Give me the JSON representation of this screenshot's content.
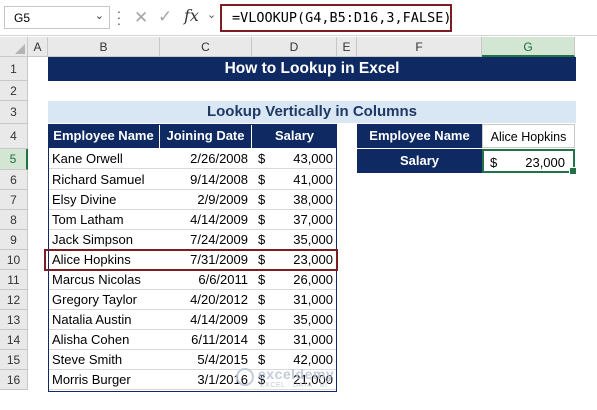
{
  "formula_bar": {
    "name_box": "G5",
    "formula": "=VLOOKUP(G4,B5:D16,3,FALSE)",
    "fx_label": "fx"
  },
  "columns": [
    "A",
    "B",
    "C",
    "D",
    "E",
    "F",
    "G"
  ],
  "rows": [
    "1",
    "2",
    "3",
    "4",
    "5",
    "6",
    "7",
    "8",
    "9",
    "10",
    "11",
    "12",
    "13",
    "14",
    "15",
    "16"
  ],
  "selected_cell": {
    "column": "G",
    "row": "5"
  },
  "sheet": {
    "title": "How to Lookup in Excel",
    "subtitle": "Lookup Vertically in Columns"
  },
  "table": {
    "headers": [
      "Employee Name",
      "Joining Date",
      "Salary"
    ],
    "currency_symbol": "$",
    "rows": [
      {
        "name": "Kane Orwell",
        "date": "2/26/2008",
        "salary": "43,000"
      },
      {
        "name": "Richard Samuel",
        "date": "9/14/2008",
        "salary": "41,000"
      },
      {
        "name": "Elsy Divine",
        "date": "2/9/2009",
        "salary": "38,000"
      },
      {
        "name": "Tom Latham",
        "date": "4/14/2009",
        "salary": "37,000"
      },
      {
        "name": "Jack Simpson",
        "date": "7/24/2009",
        "salary": "35,000"
      },
      {
        "name": "Alice Hopkins",
        "date": "7/31/2009",
        "salary": "23,000"
      },
      {
        "name": "Marcus Nicolas",
        "date": "6/6/2011",
        "salary": "26,000"
      },
      {
        "name": "Gregory Taylor",
        "date": "4/20/2012",
        "salary": "31,000"
      },
      {
        "name": "Natalia Austin",
        "date": "4/14/2009",
        "salary": "35,000"
      },
      {
        "name": "Alisha Cohen",
        "date": "6/11/2014",
        "salary": "31,000"
      },
      {
        "name": "Steve Smith",
        "date": "5/4/2015",
        "salary": "42,000"
      },
      {
        "name": "Morris Burger",
        "date": "3/1/2016",
        "salary": "21,000"
      }
    ],
    "highlighted_row": "Alice Hopkins"
  },
  "lookup": {
    "name_label": "Employee Name",
    "name_value": "Alice Hopkins",
    "salary_label": "Salary",
    "salary_currency": "$",
    "salary_value": "23,000"
  },
  "watermark": {
    "brand": "exceldemy",
    "tagline": "EXCEL · DATA · BI"
  },
  "colors": {
    "header_navy": "#0f2a63",
    "subtitle_fill": "#d9e7f5",
    "highlight_border": "#7a1e22",
    "selection_green": "#217346"
  }
}
